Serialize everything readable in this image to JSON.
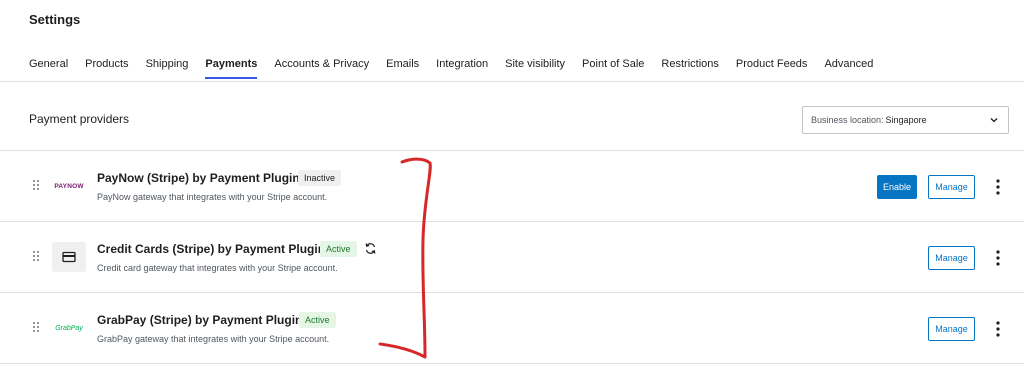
{
  "header": {
    "title": "Settings",
    "tabs": [
      "General",
      "Products",
      "Shipping",
      "Payments",
      "Accounts & Privacy",
      "Emails",
      "Integration",
      "Site visibility",
      "Point of Sale",
      "Restrictions",
      "Product Feeds",
      "Advanced"
    ],
    "active_tab": "Payments"
  },
  "section": {
    "title": "Payment providers",
    "location_label": "Business location:",
    "location_value": "Singapore"
  },
  "providers": [
    {
      "logo_text": "PAYNOW",
      "name": "PayNow (Stripe) by Payment Plugins",
      "status": "Inactive",
      "description": "PayNow gateway that integrates with your Stripe account.",
      "enable_label": "Enable",
      "manage_label": "Manage"
    },
    {
      "logo_icon": "credit-card-icon",
      "name": "Credit Cards (Stripe) by Payment Plugins",
      "status": "Active",
      "description": "Credit card gateway that integrates with your Stripe account.",
      "manage_label": "Manage"
    },
    {
      "logo_text": "GrabPay",
      "name": "GrabPay (Stripe) by Payment Plugins",
      "status": "Active",
      "description": "GrabPay gateway that integrates with your Stripe account.",
      "manage_label": "Manage"
    }
  ],
  "colors": {
    "primary": "#0675c4",
    "active_tab_underline": "#3858e9",
    "active_badge_bg": "#e6f6e6",
    "annotation": "#d62828"
  }
}
